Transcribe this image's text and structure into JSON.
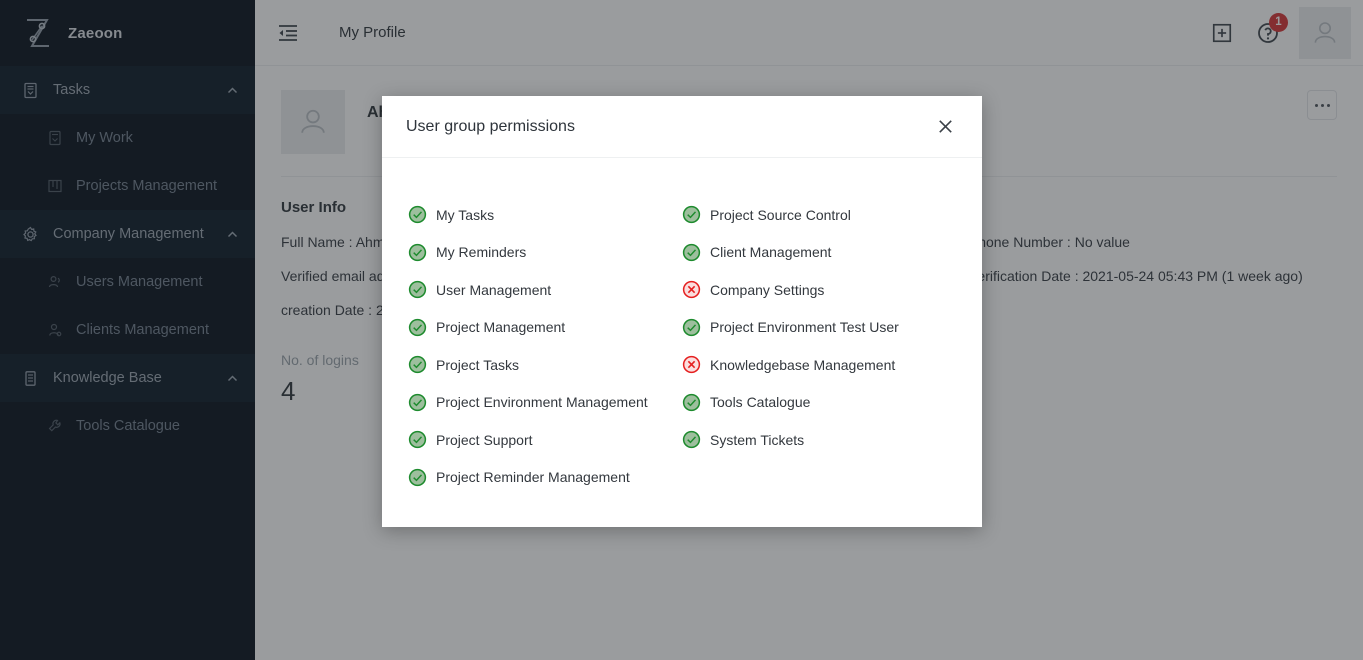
{
  "sidebar": {
    "brand": {
      "name": "Zaeoon",
      "logo_icon": "zaeoon-logo-icon"
    },
    "sections": [
      {
        "label": "Tasks",
        "icon": "tasks-icon",
        "chevron": "chevron-up-icon",
        "items": [
          {
            "label": "My Work",
            "icon": "my-work-icon"
          },
          {
            "label": "Projects Management",
            "icon": "board-icon"
          }
        ]
      },
      {
        "label": "Company Management",
        "icon": "gear-icon",
        "chevron": "chevron-up-icon",
        "items": [
          {
            "label": "Users Management",
            "icon": "users-icon"
          },
          {
            "label": "Clients Management",
            "icon": "user-cog-icon"
          }
        ]
      },
      {
        "label": "Knowledge Base",
        "icon": "book-icon",
        "chevron": "chevron-up-icon",
        "items": [
          {
            "label": "Tools Catalogue",
            "icon": "wrench-icon"
          }
        ]
      }
    ]
  },
  "topbar": {
    "menu_toggle_icon": "collapse-menu-icon",
    "title": "My Profile",
    "add_icon": "plus-square-icon",
    "help_icon": "help-circle-icon",
    "help_badge": "1",
    "avatar_icon": "user-avatar-icon"
  },
  "profile": {
    "avatar_icon": "user-avatar-icon",
    "name": "Ahm",
    "more_icon": "ellipsis-icon",
    "section_title": "User Info",
    "fields_left": [
      {
        "key": "Full Name :",
        "value": "Ahm"
      },
      {
        "key": "Verified email ad",
        "value": ""
      },
      {
        "key": "creation Date :",
        "value": "2"
      }
    ],
    "fields_right": [
      {
        "key": "Phone Number :",
        "value": "No value"
      },
      {
        "key": "Verification Date :",
        "value": "2021-05-24 05:43 PM (1 week ago)"
      }
    ],
    "logins_label": "No. of logins",
    "logins_value": "4"
  },
  "modal": {
    "title": "User group permissions",
    "close_icon": "close-icon",
    "granted_icon": "check-circle-icon",
    "denied_icon": "x-circle-icon",
    "colors": {
      "granted": "#1e8b2e",
      "granted_fill": "#9dbf9d",
      "denied": "#e52020",
      "denied_fill": "#fbdede"
    },
    "permissions_left": [
      {
        "label": "My Tasks",
        "granted": true
      },
      {
        "label": "My Reminders",
        "granted": true
      },
      {
        "label": "User Management",
        "granted": true
      },
      {
        "label": "Project Management",
        "granted": true
      },
      {
        "label": "Project Tasks",
        "granted": true
      },
      {
        "label": "Project Environment Management",
        "granted": true
      },
      {
        "label": "Project Support",
        "granted": true
      },
      {
        "label": "Project Reminder Management",
        "granted": true
      }
    ],
    "permissions_right": [
      {
        "label": "Project Source Control",
        "granted": true
      },
      {
        "label": "Client Management",
        "granted": true
      },
      {
        "label": "Company Settings",
        "granted": false
      },
      {
        "label": "Project Environment Test User",
        "granted": true
      },
      {
        "label": "Knowledgebase Management",
        "granted": false
      },
      {
        "label": "Tools Catalogue",
        "granted": true
      },
      {
        "label": "System Tickets",
        "granted": true
      }
    ]
  }
}
